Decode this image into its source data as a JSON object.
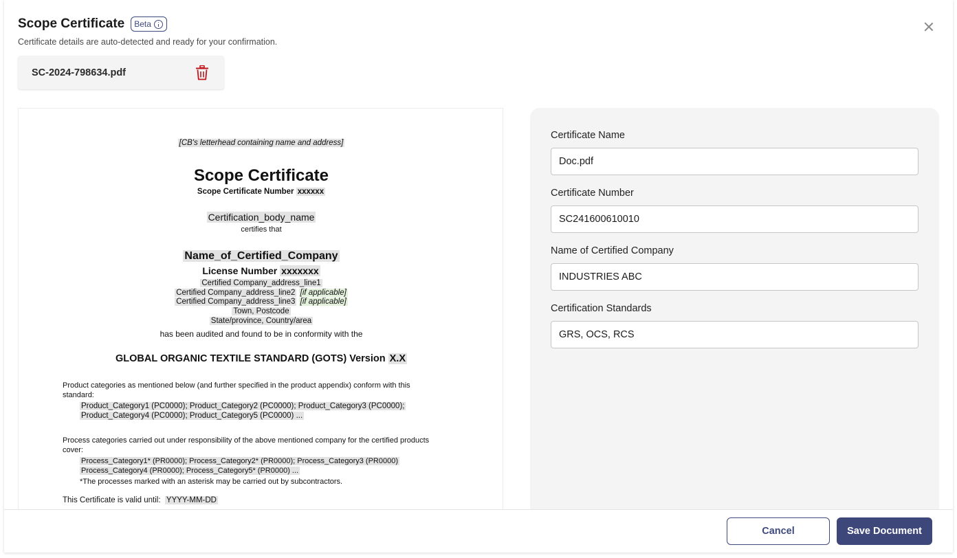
{
  "header": {
    "title": "Scope Certificate",
    "badge": "Beta",
    "subtitle": "Certificate details are auto-detected and ready for your confirmation."
  },
  "file": {
    "name": "SC-2024-798634.pdf"
  },
  "document": {
    "letterhead": "[CB's letterhead containing name and address]",
    "title": "Scope Certificate",
    "number_label": "Scope Certificate Number",
    "number_value": "xxxxxx",
    "cert_body": "Certification_body_name",
    "certifies": "certifies that",
    "company": "Name_of_Certified_Company",
    "license_label": "License Number",
    "license_value": "xxxxxxx",
    "address1": "Certified Company_address_line1",
    "address2": "Certified Company_address_line2",
    "address3": "Certified Company_address_line3",
    "if_applicable": "[if applicable]",
    "town": "Town, Postcode",
    "state": "State/province, Country/area",
    "audited": "has been audited and found to be in conformity with the",
    "standard": "GLOBAL ORGANIC TEXTILE STANDARD (GOTS)  Version",
    "version": "X.X",
    "product_intro_1": "Product categories as mentioned below (and further specified in the product appendix) conform with this",
    "product_intro_2": "standard:",
    "product_line_1": "Product_Category1 (PC0000); Product_Category2 (PC0000); Product_Category3 (PC0000);",
    "product_line_2": "Product_Category4 (PC0000); Product_Category5 (PC0000) ...",
    "process_intro_1": "Process categories carried out under responsibility of the above mentioned company for the certified products",
    "process_intro_2": "cover:",
    "process_line_1": "Process_Category1* (PR0000); Process_Category2* (PR0000); Process_Category3 (PR0000)",
    "process_line_2": "Process_Category4 (PR0000); Process_Category5* (PR0000) ...",
    "asterisk_note": "*The processes marked with an asterisk may be carried out by subcontractors.",
    "valid_label": "This Certificate is valid until:",
    "valid_value": "YYYY-MM-DD"
  },
  "form": {
    "certificate_name": {
      "label": "Certificate Name",
      "value": "Doc.pdf"
    },
    "certificate_number": {
      "label": "Certificate Number",
      "value": "SC241600610010"
    },
    "company_name": {
      "label": "Name of Certified Company",
      "value": "INDUSTRIES ABC"
    },
    "standards": {
      "label": "Certification Standards",
      "value": "GRS, OCS, RCS"
    }
  },
  "footer": {
    "cancel_label": "Cancel",
    "save_label": "Save Document"
  },
  "colors": {
    "primary": "#3e4779",
    "delete": "#c0161d",
    "panel": "#f4f4f4"
  },
  "icons": {
    "close": "close-icon",
    "delete": "trash-icon",
    "info": "info-icon"
  }
}
